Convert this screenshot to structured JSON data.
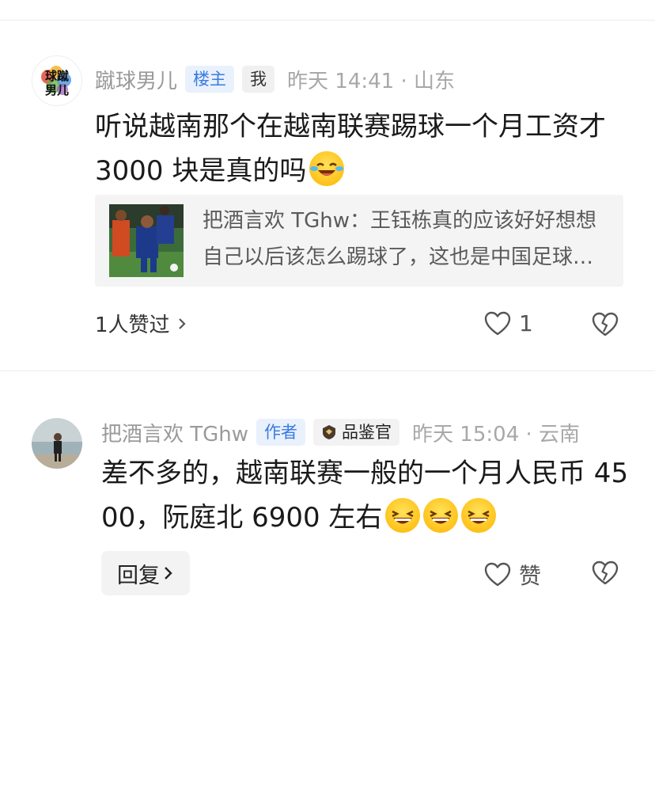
{
  "comments": [
    {
      "username": "蹴球男儿",
      "badges": [
        "楼主",
        "我"
      ],
      "time": "昨天 14:41 · 山东",
      "text": "听说越南那个在越南联赛踢球一个月工资才 3000 块是真的吗",
      "emoji": "laughing-crying-emoji",
      "quote": "把酒言欢 TGhw：王钰栋真的应该好好想想自己以后该怎么踢球了，这也是中国足球最核心的问题",
      "likers": "1人赞过",
      "likes": "1"
    },
    {
      "username": "把酒言欢 TGhw",
      "badges": [
        "作者"
      ],
      "rank_badge": "品鉴官",
      "time": "昨天 15:04 · 云南",
      "text": "差不多的，越南联赛一般的一个月人民币 4500，阮庭北 6900 左右",
      "emojis": [
        "grinning-emoji",
        "grinning-emoji",
        "grinning-emoji"
      ],
      "reply_label": "回复",
      "like_label": "赞"
    }
  ],
  "colors": {
    "badge_blue": "#3b7bdf",
    "badge_blue_bg": "#e9f1fd",
    "meta_gray": "#a3a3a3"
  }
}
